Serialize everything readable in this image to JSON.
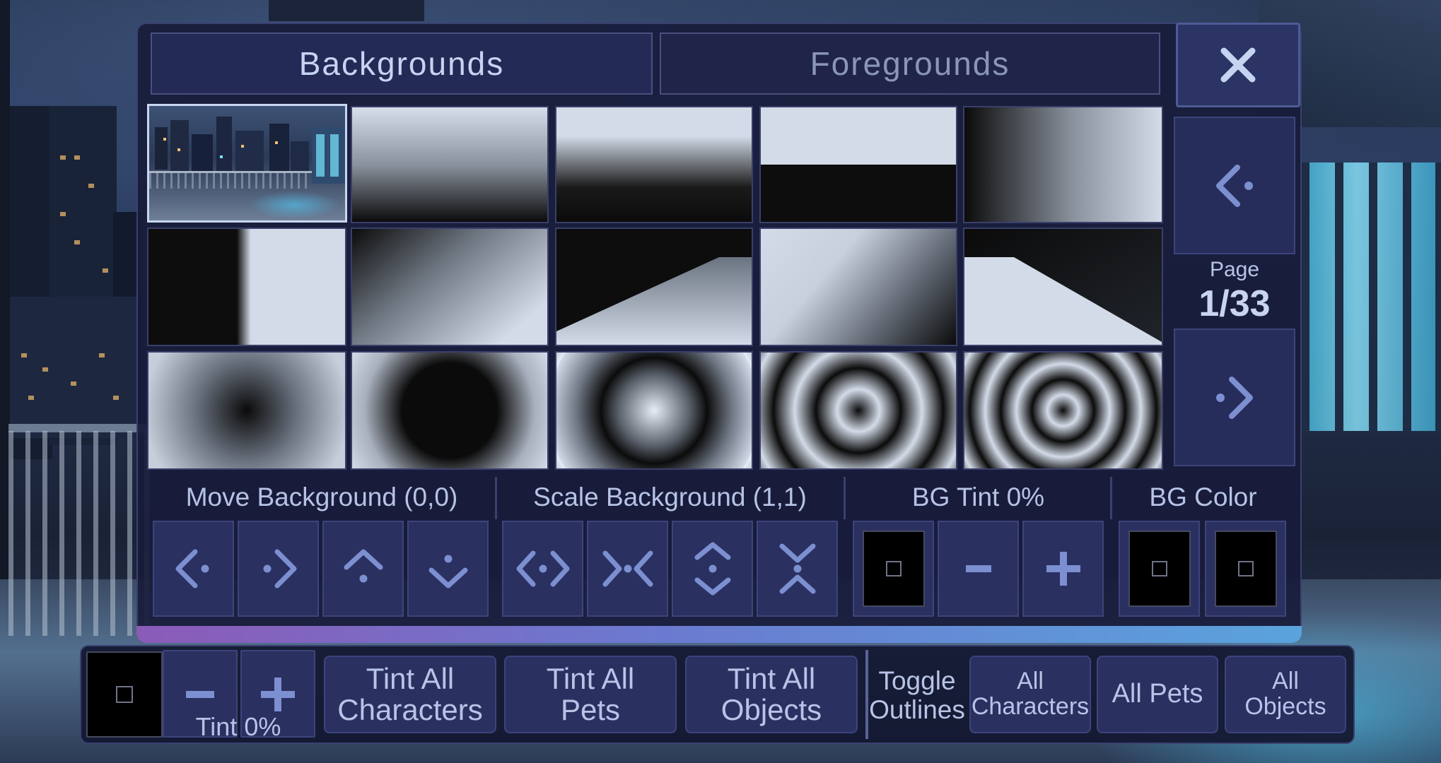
{
  "tabs": [
    {
      "label": "Backgrounds",
      "active": true
    },
    {
      "label": "Foregrounds",
      "active": false
    }
  ],
  "close_icon": "close-icon",
  "grid": {
    "thumbnails": [
      "city-rooftop-night",
      "gradient-vertical-light-to-dark",
      "gradient-top-light-bottom-dark-soft",
      "hard-split-light-top-dark-bottom",
      "gradient-horizontal-dark-to-light",
      "hard-split-dark-left-light-right",
      "diagonal-gradient",
      "perspective-floor-light",
      "diagonal-gradient-light",
      "perspective-floor-dark",
      "radial-dark-center",
      "radial-large-dark-center",
      "radial-light-center",
      "concentric-rings",
      "concentric-rings-dense"
    ],
    "selected_index": 0
  },
  "pagination": {
    "prev_icon": "chevron-left-icon",
    "page_label": "Page",
    "page_value": "1/33",
    "next_icon": "chevron-right-icon"
  },
  "sections": {
    "move_label": "Move Background (0,0)",
    "scale_label": "Scale Background (1,1)",
    "tint_label": "BG Tint 0%",
    "color_label": "BG Color"
  },
  "bottom": {
    "tint_minus": "-",
    "tint_plus": "+",
    "tint_label": "Tint 0%",
    "tint_all_characters": [
      "Tint All",
      "Characters"
    ],
    "tint_all_pets": [
      "Tint All",
      "Pets"
    ],
    "tint_all_objects": [
      "Tint All",
      "Objects"
    ],
    "toggle_outlines": [
      "Toggle",
      "Outlines"
    ],
    "all_characters": [
      "All",
      "Characters"
    ],
    "all_pets": "All Pets",
    "all_objects": [
      "All",
      "Objects"
    ]
  },
  "bg_tint": {
    "minus": "-",
    "plus": "+"
  },
  "colors": {
    "panel": "#181c3a",
    "button": "#2a3060",
    "text": "#b7c4e6",
    "accent_bar_start": "#8b5bb8",
    "accent_bar_end": "#5aa3dc"
  }
}
